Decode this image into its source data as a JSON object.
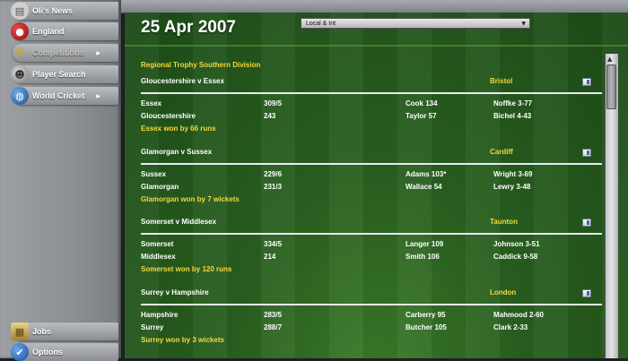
{
  "sidebar": {
    "items": [
      {
        "label": "Oli's News",
        "icon": "newspaper-icon",
        "color": "#c9c9c9",
        "chevron": false
      },
      {
        "label": "England",
        "icon": "cricket-ball-icon",
        "color": "#b71c1c",
        "chevron": false
      },
      {
        "label": "Competitions",
        "icon": "trophy-icon",
        "color": "#c9a227",
        "chevron": true
      },
      {
        "label": "Player Search",
        "icon": "person-icon",
        "color": "#9a9a9a",
        "chevron": false
      },
      {
        "label": "World Cricket",
        "icon": "globe-icon",
        "color": "#2f6fb0",
        "chevron": true
      }
    ],
    "bottom": [
      {
        "label": "Jobs",
        "icon": "jobs-icon",
        "color": "#c9b060"
      },
      {
        "label": "Options",
        "icon": "check-icon",
        "color": "#2a6fc2"
      }
    ]
  },
  "header": {
    "date": "25 Apr 2007",
    "filter_value": "Local & Int"
  },
  "competition": "Regional Trophy Southern Division",
  "matches": [
    {
      "title": "Gloucestershire v Essex",
      "venue": "Bristol",
      "rows": [
        {
          "team": "Essex",
          "score": "309/5",
          "bat": "Cook 134",
          "bowl": "Noffke 3-77"
        },
        {
          "team": "Gloucestershire",
          "score": "243",
          "bat": "Taylor 57",
          "bowl": "Bichel 4-43"
        }
      ],
      "result": "Essex won by 66 runs"
    },
    {
      "title": "Glamorgan v Sussex",
      "venue": "Cardiff",
      "rows": [
        {
          "team": "Sussex",
          "score": "229/6",
          "bat": "Adams 103*",
          "bowl": "Wright 3-69"
        },
        {
          "team": "Glamorgan",
          "score": "231/3",
          "bat": "Wallace 54",
          "bowl": "Lewry 3-48"
        }
      ],
      "result": "Glamorgan won by 7 wickets"
    },
    {
      "title": "Somerset v Middlesex",
      "venue": "Taunton",
      "rows": [
        {
          "team": "Somerset",
          "score": "334/5",
          "bat": "Langer 109",
          "bowl": "Johnson 3-51"
        },
        {
          "team": "Middlesex",
          "score": "214",
          "bat": "Smith 106",
          "bowl": "Caddick 9-58"
        }
      ],
      "result": "Somerset won by 120 runs"
    },
    {
      "title": "Surrey v Hampshire",
      "venue": "London",
      "rows": [
        {
          "team": "Hampshire",
          "score": "283/5",
          "bat": "Carberry 95",
          "bowl": "Mahmood 2-60"
        },
        {
          "team": "Surrey",
          "score": "288/7",
          "bat": "Butcher 105",
          "bowl": "Clark 2-33"
        }
      ],
      "result": "Surrey won by 3 wickets"
    }
  ]
}
